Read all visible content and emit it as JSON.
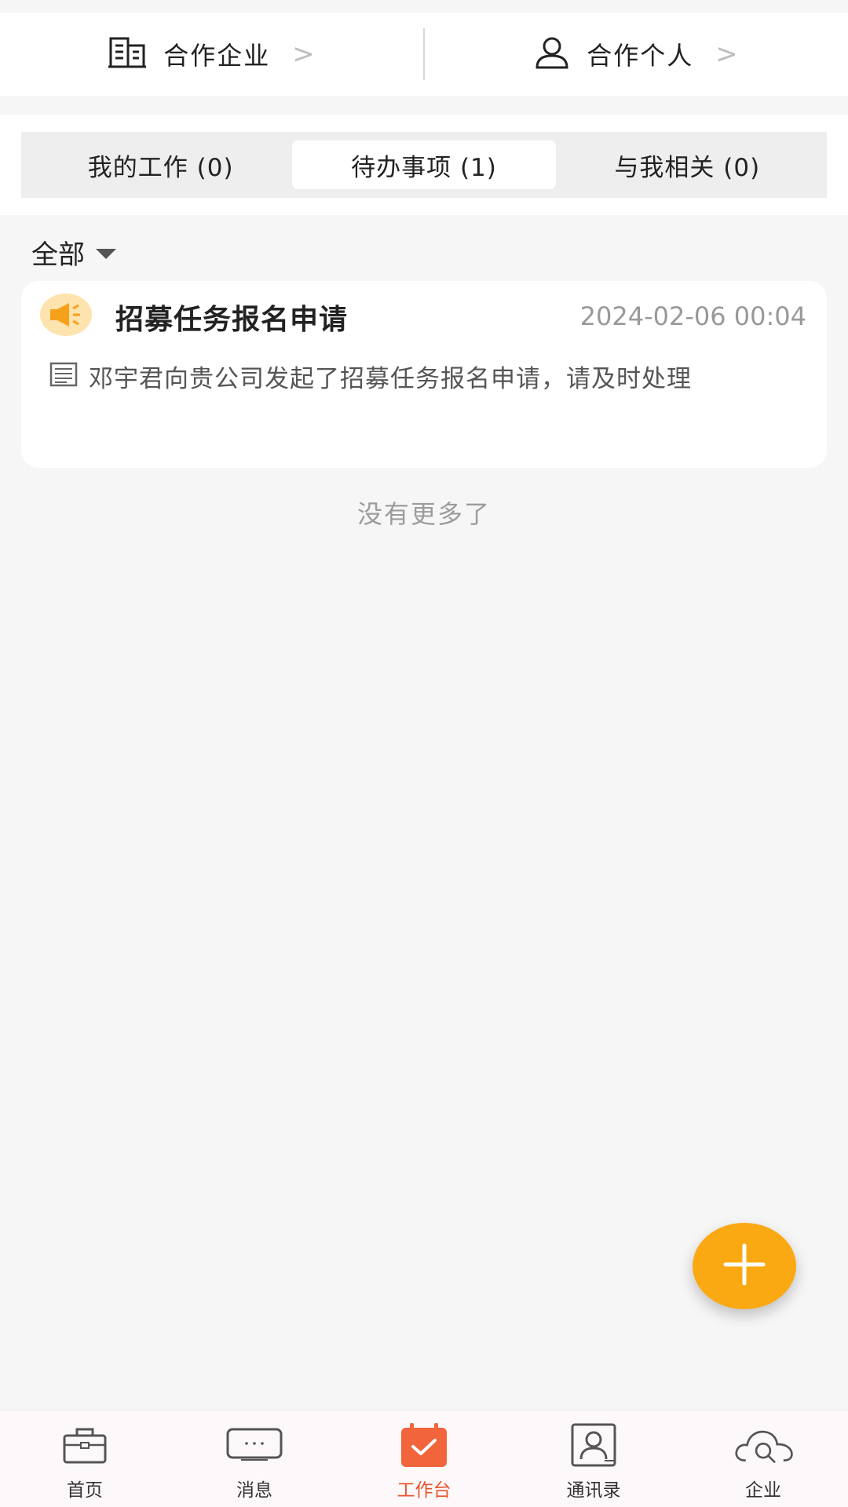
{
  "partners": {
    "enterprise_label": "合作企业",
    "enterprise_icon": "building-icon",
    "individual_label": "合作个人",
    "individual_icon": "person-icon"
  },
  "tabs": [
    {
      "label": "我的工作 (0)",
      "active": false
    },
    {
      "label": "待办事项 (1)",
      "active": true
    },
    {
      "label": "与我相关 (0)",
      "active": false
    }
  ],
  "filter": {
    "label": "全部"
  },
  "tasks": [
    {
      "icon": "megaphone-icon",
      "title": "招募任务报名申请",
      "time": "2024-02-06 00:04",
      "description": "邓宇君向贵公司发起了招募任务报名申请，请及时处理"
    }
  ],
  "no_more_text": "没有更多了",
  "fab": {
    "icon": "plus-icon",
    "color": "#fba913"
  },
  "bottom_nav": [
    {
      "label": "首页",
      "icon": "briefcase-icon",
      "active": false
    },
    {
      "label": "消息",
      "icon": "message-icon",
      "active": false
    },
    {
      "label": "工作台",
      "icon": "workbench-icon",
      "active": true
    },
    {
      "label": "通讯录",
      "icon": "contacts-icon",
      "active": false
    },
    {
      "label": "企业",
      "icon": "cloud-search-icon",
      "active": false
    }
  ],
  "colors": {
    "accent": "#e8542c",
    "fab": "#fba913",
    "icon_bg": "#fde3ad"
  }
}
